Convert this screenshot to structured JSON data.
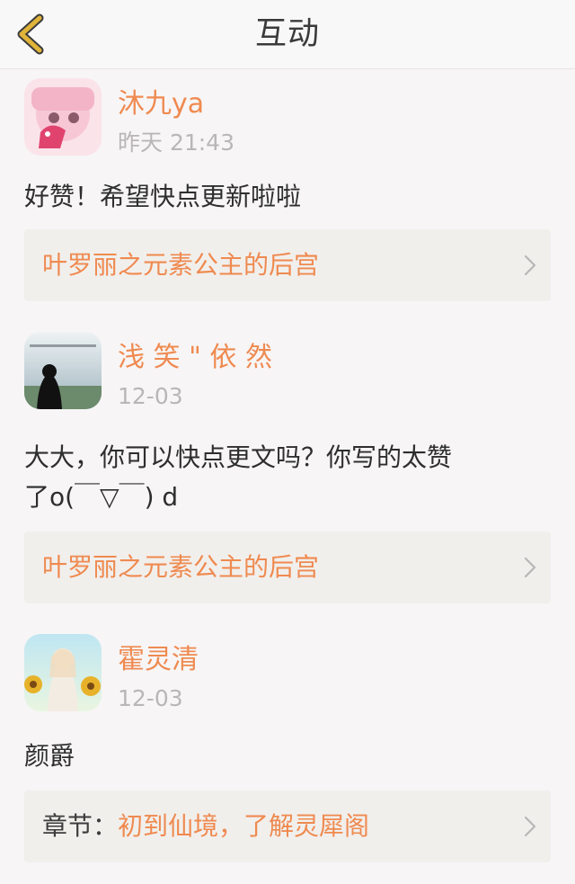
{
  "header": {
    "title": "互动",
    "back_icon": "chevron-left-icon",
    "back_color": "#e0b43a"
  },
  "colors": {
    "accent": "#ef8a50",
    "time_gray": "#b9b6b7",
    "text": "#2e2e2e"
  },
  "posts": [
    {
      "author": "沐九ya",
      "time": "昨天 21:43",
      "text": "好赞！希望快点更新啦啦",
      "ref_prefix": "",
      "ref_title": "叶罗丽之元素公主的后宫"
    },
    {
      "author": "浅 笑 \" 依 然",
      "time": "12-03",
      "text_line1": "大大，你可以快点更文吗？你写的太赞",
      "text_line2": "了o(￣▽￣) d",
      "ref_prefix": "",
      "ref_title": "叶罗丽之元素公主的后宫"
    },
    {
      "author": "霍灵清",
      "time": "12-03",
      "text": "颜爵",
      "ref_prefix": "章节：",
      "ref_title": "初到仙境，了解灵犀阁"
    }
  ]
}
